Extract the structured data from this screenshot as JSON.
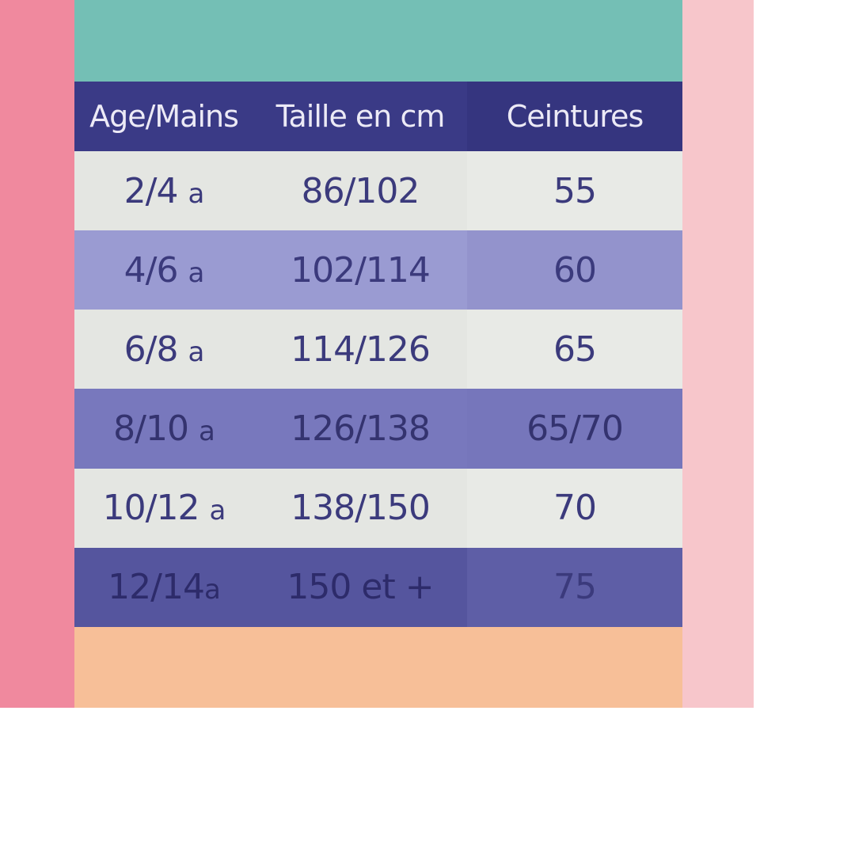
{
  "colors": {
    "left_band": "#f0899e",
    "right_band": "#f7c6cb",
    "top_band": "#74bfb5",
    "bottom_band": "#f7bf98",
    "header_bg": "#3a3a86",
    "text_dark": "#3b3a7c"
  },
  "table": {
    "headers": [
      "Age/Mains",
      "Taille en cm",
      "Ceintures"
    ],
    "rows": [
      {
        "age": "2/4",
        "unit": "a",
        "taille": "86/102",
        "ceinture": "55"
      },
      {
        "age": "4/6",
        "unit": "a",
        "taille": "102/114",
        "ceinture": "60"
      },
      {
        "age": "6/8",
        "unit": "a",
        "taille": "114/126",
        "ceinture": "65"
      },
      {
        "age": "8/10",
        "unit": "a",
        "taille": "126/138",
        "ceinture": "65/70"
      },
      {
        "age": "10/12",
        "unit": "a",
        "taille": "138/150",
        "ceinture": "70"
      },
      {
        "age": "12/14",
        "unit": "a",
        "taille": "150 et +",
        "ceinture": "75"
      }
    ]
  }
}
